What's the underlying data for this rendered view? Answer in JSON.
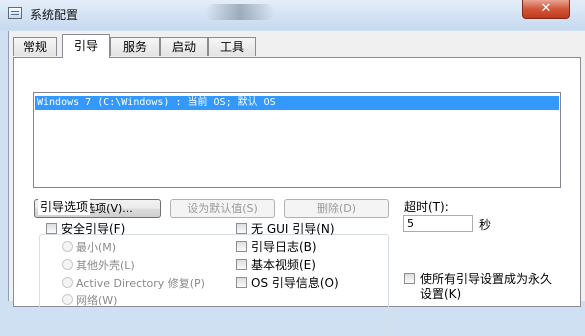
{
  "window": {
    "title": "系统配置",
    "close_glyph": "✕"
  },
  "tabs": [
    {
      "label": "常规"
    },
    {
      "label": "引导"
    },
    {
      "label": "服务"
    },
    {
      "label": "启动"
    },
    {
      "label": "工具"
    }
  ],
  "boot_list": {
    "entries": [
      "Windows 7 (C:\\Windows) : 当前 OS; 默认 OS"
    ]
  },
  "buttons": {
    "advanced": "高级选项(V)...",
    "set_default": "设为默认值(S)",
    "delete": "删除(D)"
  },
  "boot_options": {
    "group_label": "引导选项",
    "safe_boot": "安全引导(F)",
    "minimal": "最小(M)",
    "alternate_shell": "其他外壳(L)",
    "active_directory": "Active Directory 修复(P)",
    "network": "网络(W)",
    "no_gui": "无 GUI 引导(N)",
    "boot_log": "引导日志(B)",
    "base_video": "基本视频(E)",
    "os_boot_info": "OS 引导信息(O)"
  },
  "timeout": {
    "label": "超时(T):",
    "value": "5",
    "unit": "秒"
  },
  "permanent": {
    "label_line1": "使所有引导设置成为永久",
    "label_line2": "设置(K)"
  }
}
